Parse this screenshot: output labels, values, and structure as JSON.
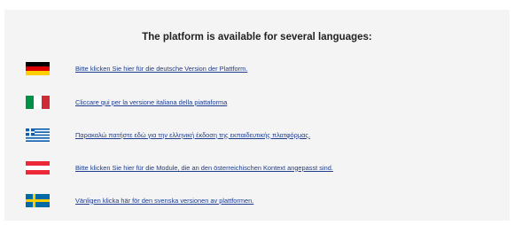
{
  "heading": "The platform is available for several languages:",
  "languages": [
    {
      "flag": "germany-flag-icon",
      "text": "Bitte klicken Sie hier für die deutsche Version der Plattform."
    },
    {
      "flag": "italy-flag-icon",
      "text": "Cliccare qui per la versione italiana della piattaforma"
    },
    {
      "flag": "greece-flag-icon",
      "text": "Παρακαλώ πατήστε εδώ για την ελληνική έκδοση της εκπαιδευτικής πλατφόρμας."
    },
    {
      "flag": "austria-flag-icon",
      "text": "Bitte klicken Sie hier für die Module, die an den österreichischen Kontext angepasst sind."
    },
    {
      "flag": "sweden-flag-icon",
      "text": "Vänligen klicka här för den svenska versionen av plattformen."
    }
  ],
  "colors": {
    "link": "#1f3d8f",
    "panel_background": "#f4f4f4"
  }
}
